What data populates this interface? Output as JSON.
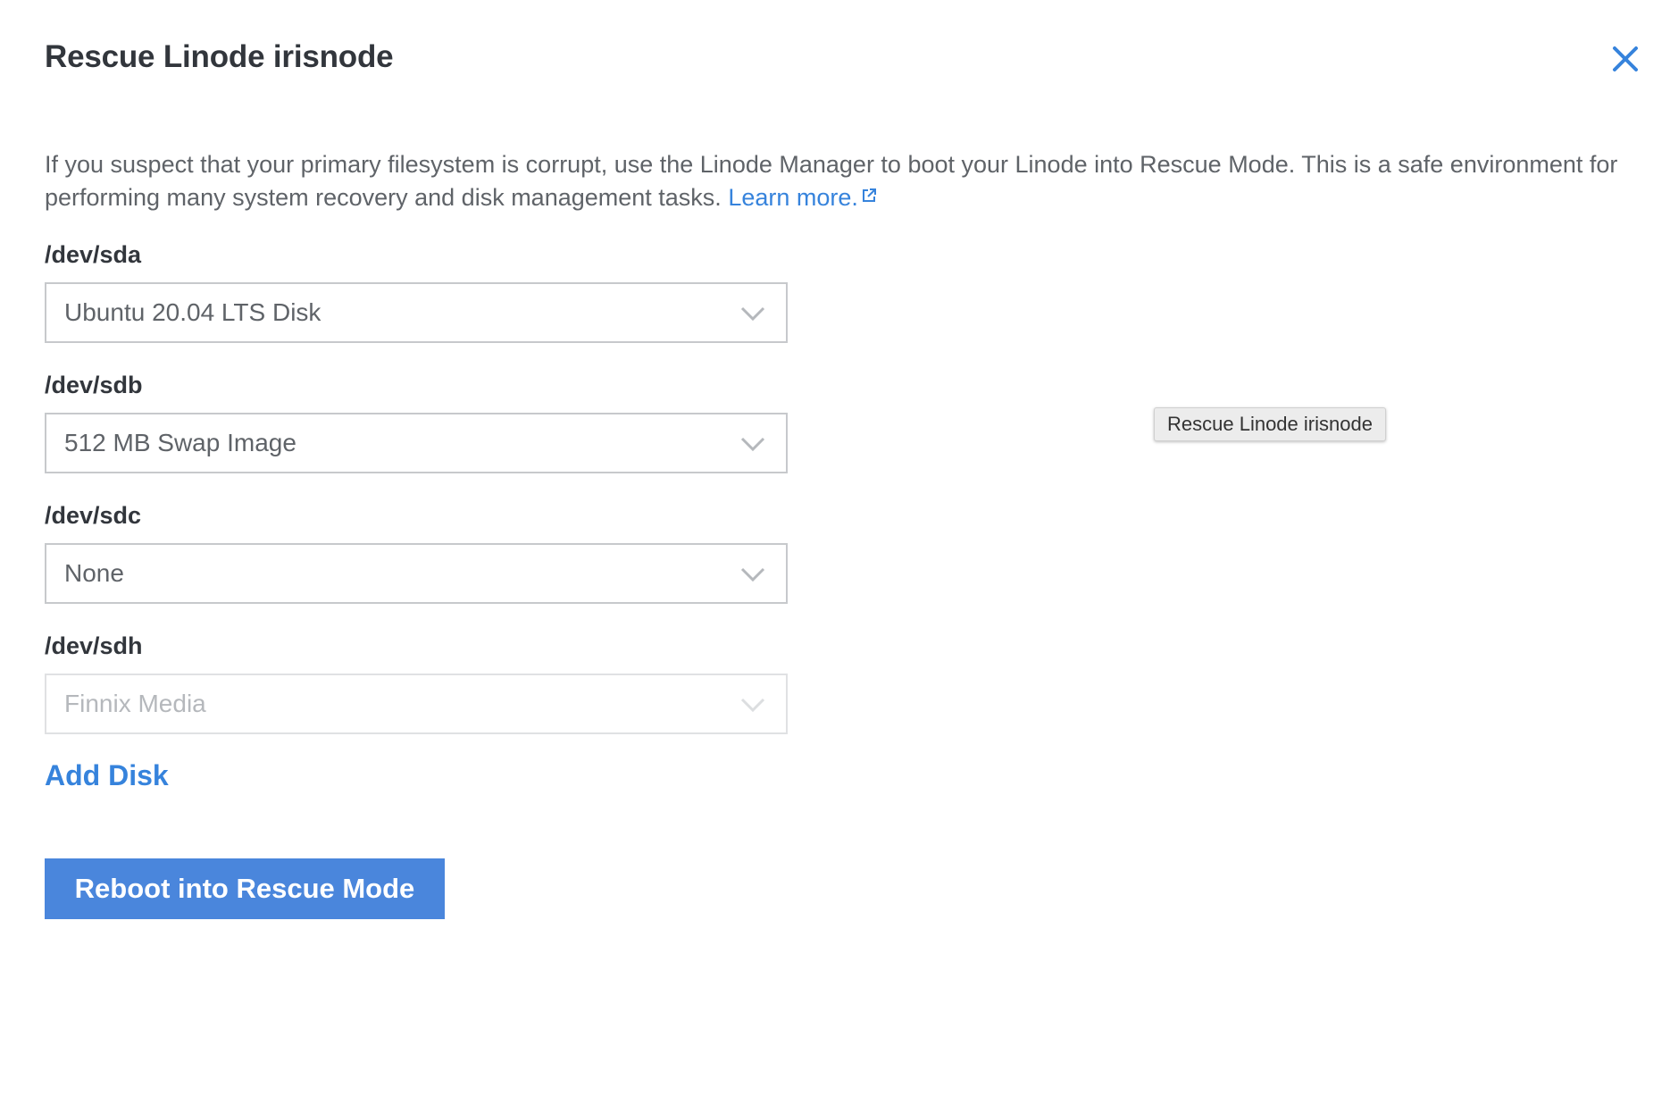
{
  "dialog": {
    "title": "Rescue Linode irisnode",
    "description": "If you suspect that your primary filesystem is corrupt, use the Linode Manager to boot your Linode into Rescue Mode. This is a safe environment for performing many system recovery and disk management tasks.",
    "learn_more": "Learn more.",
    "close_icon": "close-icon"
  },
  "devices": [
    {
      "label": "/dev/sda",
      "value": "Ubuntu 20.04 LTS Disk",
      "disabled": false
    },
    {
      "label": "/dev/sdb",
      "value": "512 MB Swap Image",
      "disabled": false
    },
    {
      "label": "/dev/sdc",
      "value": "None",
      "disabled": false
    },
    {
      "label": "/dev/sdh",
      "value": "Finnix Media",
      "disabled": true
    }
  ],
  "add_disk_label": "Add Disk",
  "submit_label": "Reboot into Rescue Mode",
  "tooltip": "Rescue Linode irisnode",
  "colors": {
    "accent": "#3683dc",
    "button": "#4a86dc",
    "text": "#32363c",
    "muted": "#5f6368"
  }
}
